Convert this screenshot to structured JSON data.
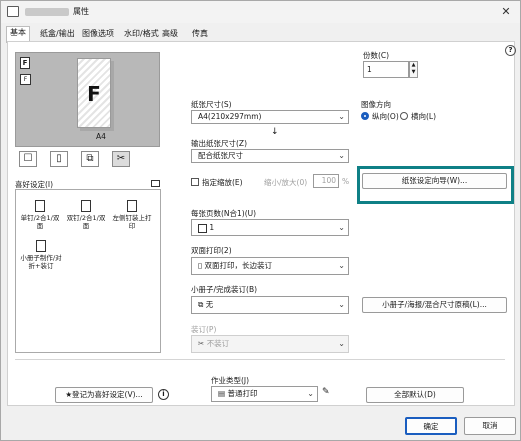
{
  "window": {
    "title": "属性",
    "close": "✕"
  },
  "tabs": [
    {
      "label": "基本"
    },
    {
      "label": "纸盒/输出"
    },
    {
      "label": "图像选项"
    },
    {
      "label": "水印/格式"
    },
    {
      "label": "高级"
    },
    {
      "label": "传真"
    }
  ],
  "help": "?",
  "copies": {
    "label": "份数(C)",
    "value": "1",
    "up": "▲",
    "down": "▼"
  },
  "preview": {
    "paper": "A4",
    "page_letter": "F"
  },
  "paper_size": {
    "label": "纸张尺寸(S)",
    "value": "A4(210x297mm)"
  },
  "arrow": "↓",
  "output_size": {
    "label": "输出纸张尺寸(Z)",
    "value": "配合纸张尺寸"
  },
  "orientation": {
    "label": "图像方向",
    "portrait": "纵向(O)",
    "landscape": "横向(L)"
  },
  "zoom": {
    "checkbox": "指定缩放(E)",
    "label": "缩小/放大(0)",
    "value": "100",
    "unit": "%"
  },
  "guide_button": "纸张设定向导(W)...",
  "favorites": {
    "label": "喜好设定(I)",
    "items": [
      {
        "label": "单钉/2合1/双面"
      },
      {
        "label": "双钉/2合1/双面"
      },
      {
        "label": "左侧钉装上打印"
      },
      {
        "label": "小册子制作/对折+装订"
      }
    ]
  },
  "nup": {
    "label": "每张页数(N合1)(U)",
    "value": "1"
  },
  "duplex": {
    "label": "双面打印(2)",
    "value": "双面打印，长边装订"
  },
  "booklet": {
    "label": "小册子/完成装订(B)",
    "value": "无",
    "button": "小册子/海报/混合尺寸原稿(L)..."
  },
  "staple": {
    "label": "装订(P)",
    "value": "不装订"
  },
  "job_type": {
    "label": "作业类型(J)",
    "value": "普通打印"
  },
  "fav_register": "登记为喜好设定(V)...",
  "info_icon": "i",
  "restore_defaults": "全部默认(D)",
  "ok": "确定",
  "cancel": "取消"
}
